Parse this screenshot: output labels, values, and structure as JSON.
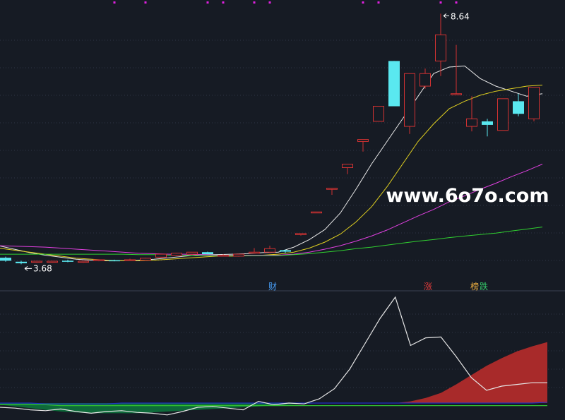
{
  "chart_data": [
    {
      "type": "candlestick",
      "title": "",
      "price_annotations": {
        "high_label": "8.64",
        "low_label": "3.68"
      },
      "event_markers": [
        {
          "label": "财",
          "bar_index": 17,
          "color": "#4aa3ff"
        },
        {
          "label": "涨",
          "bar_index": 27,
          "color": "#e03b3b"
        },
        {
          "label": "榜",
          "bar_index": 30,
          "color": "#f0b040"
        },
        {
          "label": "跌",
          "bar_index": 30,
          "color": "#35c86a"
        }
      ],
      "grid": true,
      "ylim": [
        3.3,
        8.8
      ],
      "candles": [
        {
          "o": 3.79,
          "h": 3.81,
          "l": 3.71,
          "c": 3.73
        },
        {
          "o": 3.71,
          "h": 3.73,
          "l": 3.66,
          "c": 3.68
        },
        {
          "o": 3.7,
          "h": 3.73,
          "l": 3.69,
          "c": 3.72
        },
        {
          "o": 3.71,
          "h": 3.73,
          "l": 3.69,
          "c": 3.72
        },
        {
          "o": 3.73,
          "h": 3.75,
          "l": 3.7,
          "c": 3.71
        },
        {
          "o": 3.71,
          "h": 3.72,
          "l": 3.69,
          "c": 3.72
        },
        {
          "o": 3.73,
          "h": 3.75,
          "l": 3.72,
          "c": 3.75
        },
        {
          "o": 3.74,
          "h": 3.75,
          "l": 3.72,
          "c": 3.73
        },
        {
          "o": 3.74,
          "h": 3.77,
          "l": 3.73,
          "c": 3.75
        },
        {
          "o": 3.74,
          "h": 3.79,
          "l": 3.73,
          "c": 3.78
        },
        {
          "o": 3.8,
          "h": 3.87,
          "l": 3.79,
          "c": 3.86
        },
        {
          "o": 3.84,
          "h": 3.89,
          "l": 3.83,
          "c": 3.88
        },
        {
          "o": 3.86,
          "h": 3.9,
          "l": 3.85,
          "c": 3.9
        },
        {
          "o": 3.9,
          "h": 3.91,
          "l": 3.86,
          "c": 3.86
        },
        {
          "o": 3.84,
          "h": 3.86,
          "l": 3.82,
          "c": 3.84
        },
        {
          "o": 3.82,
          "h": 3.87,
          "l": 3.81,
          "c": 3.86
        },
        {
          "o": 3.89,
          "h": 3.98,
          "l": 3.88,
          "c": 3.9
        },
        {
          "o": 3.9,
          "h": 4.03,
          "l": 3.88,
          "c": 3.97
        },
        {
          "o": 3.94,
          "h": 3.95,
          "l": 3.88,
          "c": 3.91
        },
        {
          "o": 4.27,
          "h": 4.27,
          "l": 4.23,
          "c": 4.27
        },
        {
          "o": 4.7,
          "h": 4.7,
          "l": 4.7,
          "c": 4.7
        },
        {
          "o": 5.17,
          "h": 5.17,
          "l": 5.04,
          "c": 5.17
        },
        {
          "o": 5.58,
          "h": 5.58,
          "l": 5.45,
          "c": 5.65
        },
        {
          "o": 6.1,
          "h": 6.1,
          "l": 5.9,
          "c": 6.14
        },
        {
          "o": 6.5,
          "h": 6.8,
          "l": 6.5,
          "c": 6.8
        },
        {
          "o": 7.7,
          "h": 7.7,
          "l": 6.8,
          "c": 6.8
        },
        {
          "o": 6.4,
          "h": 7.45,
          "l": 6.25,
          "c": 7.45
        },
        {
          "o": 7.2,
          "h": 7.55,
          "l": 7.15,
          "c": 7.45
        },
        {
          "o": 7.7,
          "h": 8.64,
          "l": 7.4,
          "c": 8.22
        },
        {
          "o": 7.05,
          "h": 8.02,
          "l": 7.05,
          "c": 7.05
        },
        {
          "o": 6.4,
          "h": 7.0,
          "l": 6.3,
          "c": 6.55
        },
        {
          "o": 6.5,
          "h": 6.55,
          "l": 6.2,
          "c": 6.43
        },
        {
          "o": 6.32,
          "h": 6.95,
          "l": 6.32,
          "c": 6.95
        },
        {
          "o": 6.9,
          "h": 7.05,
          "l": 6.6,
          "c": 6.65
        },
        {
          "o": 6.55,
          "h": 7.18,
          "l": 6.5,
          "c": 7.18
        }
      ],
      "series": [
        {
          "values": [
            4.03,
            3.96,
            3.89,
            3.84,
            3.8,
            3.76,
            3.74,
            3.73,
            3.73,
            3.74,
            3.76,
            3.79,
            3.82,
            3.85,
            3.85,
            3.86,
            3.87,
            3.89,
            3.9,
            4.0,
            4.15,
            4.35,
            4.68,
            5.15,
            5.65,
            6.1,
            6.55,
            7.0,
            7.45,
            7.58,
            7.6,
            7.35,
            7.2,
            7.1,
            7.0,
            7.05
          ],
          "color": "#e8e8e8"
        },
        {
          "values": [
            3.98,
            3.94,
            3.9,
            3.86,
            3.82,
            3.78,
            3.76,
            3.74,
            3.73,
            3.73,
            3.74,
            3.76,
            3.78,
            3.8,
            3.82,
            3.82,
            3.83,
            3.84,
            3.86,
            3.9,
            3.98,
            4.1,
            4.26,
            4.5,
            4.8,
            5.2,
            5.65,
            6.1,
            6.45,
            6.75,
            6.9,
            7.02,
            7.1,
            7.15,
            7.2,
            7.22
          ],
          "color": "#e0d020"
        },
        {
          "values": [
            4.03,
            4.02,
            4.01,
            4.0,
            3.98,
            3.96,
            3.94,
            3.92,
            3.9,
            3.88,
            3.87,
            3.86,
            3.86,
            3.85,
            3.84,
            3.84,
            3.84,
            3.84,
            3.84,
            3.86,
            3.9,
            3.96,
            4.03,
            4.12,
            4.22,
            4.34,
            4.48,
            4.62,
            4.75,
            4.9,
            5.02,
            5.15,
            5.27,
            5.4,
            5.52,
            5.65
          ],
          "color": "#e040e0"
        },
        {
          "values": [
            3.86,
            3.86,
            3.86,
            3.86,
            3.86,
            3.86,
            3.86,
            3.86,
            3.86,
            3.85,
            3.85,
            3.84,
            3.84,
            3.83,
            3.83,
            3.83,
            3.83,
            3.83,
            3.83,
            3.85,
            3.87,
            3.9,
            3.93,
            3.97,
            4.0,
            4.04,
            4.08,
            4.12,
            4.15,
            4.19,
            4.22,
            4.25,
            4.28,
            4.32,
            4.36,
            4.4
          ],
          "color": "#30d030"
        }
      ]
    },
    {
      "type": "area",
      "title": "",
      "grid": true,
      "ylim": [
        -20,
        130
      ],
      "white_line": [
        -5,
        -6,
        -8,
        -9,
        -7,
        -10,
        -12,
        -10,
        -9,
        -11,
        -12,
        -14,
        -10,
        -5,
        -4,
        -6,
        -8,
        2,
        -2,
        0,
        -1,
        5,
        17,
        40,
        70,
        100,
        125,
        68,
        77,
        78,
        55,
        30,
        15,
        20,
        22,
        24,
        24
      ],
      "red_area": [
        0,
        0,
        0,
        0,
        0,
        0,
        0,
        0,
        0,
        0,
        0,
        0,
        0,
        0,
        0,
        0,
        0,
        0,
        0,
        0,
        0,
        0,
        0,
        0,
        0,
        0,
        0,
        2,
        6,
        12,
        22,
        33,
        44,
        53,
        61,
        67,
        72
      ],
      "green_area": [
        2,
        4,
        6,
        8,
        10,
        11,
        12,
        12,
        12,
        12,
        11,
        10,
        9,
        8,
        7,
        6,
        5,
        4,
        3,
        2,
        1,
        0,
        0,
        0,
        0,
        0,
        0,
        0,
        0,
        0,
        0,
        0,
        0,
        0,
        0,
        0,
        0
      ],
      "blue_line": [
        0,
        0,
        0,
        -1,
        -1,
        -1,
        -1,
        -1,
        0,
        0,
        0,
        0,
        0,
        0,
        0,
        0,
        0,
        0,
        0,
        0,
        0,
        0,
        0,
        0,
        0,
        0,
        0,
        0,
        0,
        0,
        0,
        0,
        0,
        0,
        0,
        0,
        1
      ],
      "green_line": [
        -2,
        -2,
        -2,
        -2,
        -3,
        -3,
        -3,
        -3,
        -3,
        -3,
        -3,
        -3,
        -3,
        -3,
        -3,
        -3,
        -3,
        -3,
        -3,
        -3,
        -3,
        -3,
        -3,
        -3,
        -3,
        -3,
        -3,
        -3,
        -3,
        -3,
        -3,
        -3,
        -3,
        -3,
        -3,
        -3,
        -3
      ],
      "colors": {
        "white": "#e6e6e6",
        "red": "#a82a2a",
        "green": "#0e6a3a",
        "blue": "#2030c8",
        "lime": "#30c030"
      }
    }
  ],
  "watermark": "www.6o7o.com",
  "colors": {
    "background": "#161b24",
    "grid": "#2e3646",
    "up": "#d23232",
    "down": "#5ae8f0",
    "magenta_dots": "#e020e0"
  }
}
